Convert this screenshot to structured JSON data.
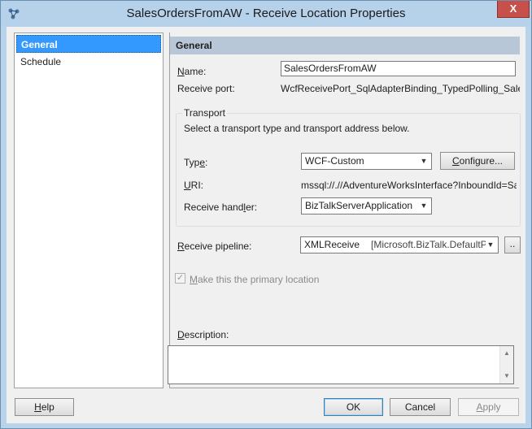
{
  "window": {
    "title": "SalesOrdersFromAW - Receive Location Properties",
    "close_label": "X"
  },
  "nav": {
    "items": [
      {
        "label": "General",
        "selected": true
      },
      {
        "label": "Schedule",
        "selected": false
      }
    ]
  },
  "general": {
    "header": "General",
    "name_label": "Name:",
    "name_value": "SalesOrdersFromAW",
    "receive_port_label": "Receive port:",
    "receive_port_value": "WcfReceivePort_SqlAdapterBinding_TypedPolling_SalesOrder",
    "transport": {
      "group_title": "Transport",
      "instruction": "Select a transport type and transport address below.",
      "type_label": "Type:",
      "type_value": "WCF-Custom",
      "configure_label": "Configure...",
      "uri_label": "URI:",
      "uri_value": "mssql://.//AdventureWorksInterface?InboundId=SalesO",
      "handler_label": "Receive handler:",
      "handler_value": "BizTalkServerApplication"
    },
    "pipeline_label": "Receive pipeline:",
    "pipeline_value": "XMLReceive",
    "pipeline_assembly": "[Microsoft.BizTalk.DefaultPip",
    "browse_label": "..",
    "primary_location_label": "Make this the primary location",
    "primary_location_checked": true,
    "description_label": "Description:",
    "description_value": ""
  },
  "footer": {
    "help_label": "Help",
    "ok_label": "OK",
    "cancel_label": "Cancel",
    "apply_label": "Apply"
  }
}
